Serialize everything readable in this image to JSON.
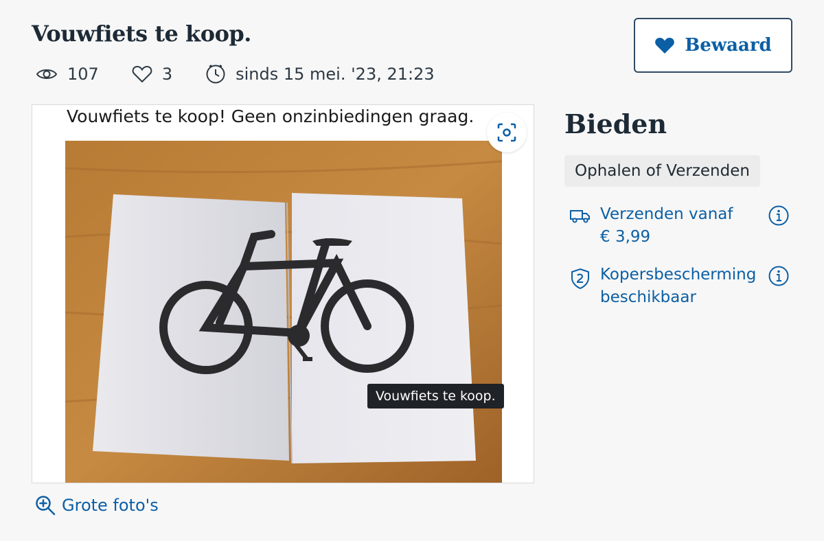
{
  "listing": {
    "title": "Vouwfiets te koop.",
    "views": "107",
    "favorites": "3",
    "date": "sinds 15 mei. '23, 21:23"
  },
  "save_button": {
    "label": "Bewaard"
  },
  "photo": {
    "caption": "Vouwfiets te koop! Geen onzinbiedingen graag.",
    "tooltip": "Vouwfiets te koop.",
    "big_photos_label": "Grote foto's"
  },
  "bid": {
    "heading": "Bieden",
    "delivery": "Ophalen of Verzenden",
    "shipping_line1": "Verzenden vanaf",
    "shipping_line2": "€ 3,99",
    "protection_line1": "Kopersbescherming",
    "protection_line2": "beschikbaar"
  },
  "colors": {
    "accent": "#0b5fa5",
    "text_dark": "#1d2a36",
    "background": "#f7f7f7"
  },
  "icons": [
    "eye-icon",
    "heart-outline-icon",
    "clock-icon",
    "heart-filled-icon",
    "scan-icon",
    "zoom-in-icon",
    "truck-icon",
    "shield-icon",
    "info-icon"
  ]
}
